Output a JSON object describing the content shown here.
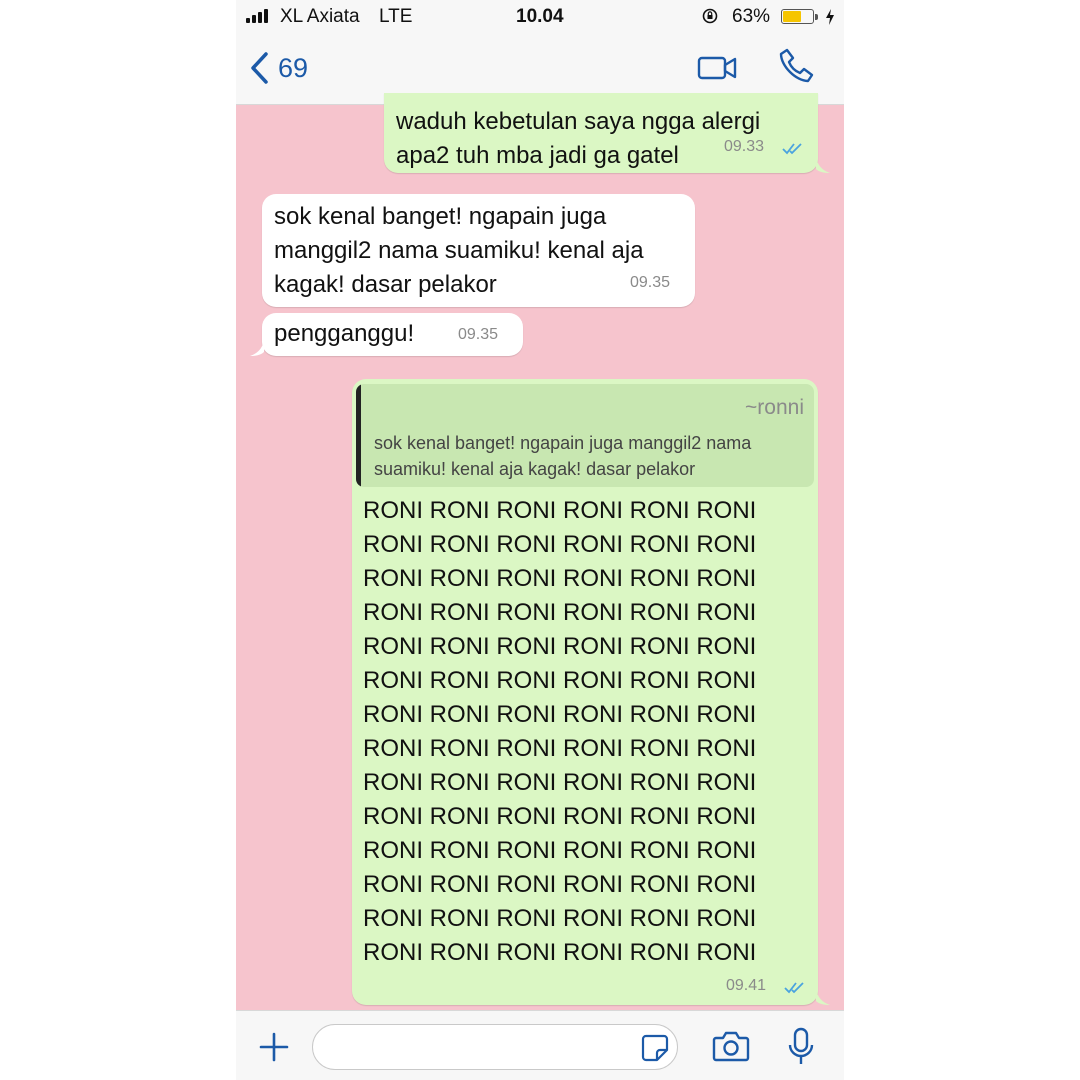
{
  "status_bar": {
    "carrier": "XL Axiata",
    "network": "LTE",
    "time": "10.04",
    "battery_percent": "63%",
    "battery_level": 0.63,
    "signal_bars": 4
  },
  "nav": {
    "back_count": "69",
    "icons": [
      "chevron-left-icon",
      "video-camera-icon",
      "phone-icon"
    ],
    "accent_color": "#1c5aa8"
  },
  "messages": [
    {
      "direction": "outgoing",
      "text": "waduh kebetulan saya ngga alergi\napa2 tuh mba jadi ga gatel",
      "time": "09.33",
      "read": true
    },
    {
      "direction": "incoming",
      "text": "sok kenal banget! ngapain juga\nmanggil2 nama suamiku! kenal aja\nkagak! dasar pelakor",
      "time": "09.35"
    },
    {
      "direction": "incoming",
      "text": "pengganggu!",
      "time": "09.35"
    },
    {
      "direction": "outgoing",
      "reply_to": {
        "author": "~ronni",
        "text": "sok kenal banget! ngapain juga manggil2 nama suamiku! kenal aja kagak! dasar pelakor"
      },
      "lines": [
        "RONI RONI RONI RONI RONI RONI",
        "RONI RONI RONI RONI RONI RONI",
        "RONI RONI RONI RONI RONI RONI",
        "RONI RONI RONI RONI RONI RONI",
        "RONI RONI RONI RONI RONI RONI",
        "RONI RONI RONI RONI RONI RONI",
        "RONI RONI RONI RONI RONI RONI",
        "RONI RONI RONI RONI RONI RONI",
        "RONI RONI RONI RONI RONI RONI",
        "RONI RONI RONI RONI RONI RONI",
        "RONI RONI RONI RONI RONI RONI",
        "RONI RONI RONI RONI RONI RONI",
        "RONI RONI RONI RONI RONI RONI",
        "RONI RONI RONI RONI RONI RONI"
      ],
      "time": "09.41",
      "read": true
    }
  ],
  "input_bar": {
    "placeholder": "",
    "icons": [
      "plus-icon",
      "sticker-icon",
      "camera-icon",
      "microphone-icon"
    ]
  },
  "colors": {
    "chat_background": "#f6c4cd",
    "outgoing_bubble": "#dbf7c4",
    "incoming_bubble": "#ffffff",
    "read_ticks": "#4aa3df",
    "battery": "#f6c500"
  }
}
